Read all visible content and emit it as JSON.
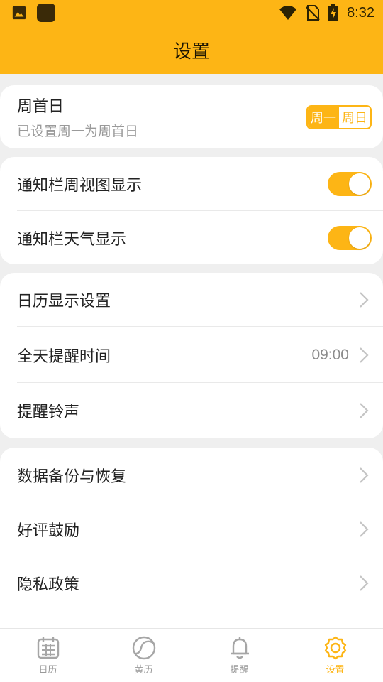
{
  "status_bar": {
    "time": "8:32"
  },
  "app_bar": {
    "title": "设置"
  },
  "first_day": {
    "title": "周首日",
    "subtitle": "已设置周一为周首日",
    "options": [
      "周一",
      "周日"
    ],
    "selected": "周一"
  },
  "toggles": [
    {
      "label": "通知栏周视图显示",
      "on": true
    },
    {
      "label": "通知栏天气显示",
      "on": true
    }
  ],
  "group_reminders": [
    {
      "label": "日历显示设置"
    },
    {
      "label": "全天提醒时间",
      "value": "09:00"
    },
    {
      "label": "提醒铃声"
    }
  ],
  "group_misc": [
    {
      "label": "数据备份与恢复"
    },
    {
      "label": "好评鼓励"
    },
    {
      "label": "隐私政策"
    }
  ],
  "bottom_nav": {
    "items": [
      {
        "label": "日历",
        "icon": "calendar-icon"
      },
      {
        "label": "黄历",
        "icon": "almanac-icon"
      },
      {
        "label": "提醒",
        "icon": "bell-icon"
      },
      {
        "label": "设置",
        "icon": "gear-icon"
      }
    ],
    "active": "设置"
  },
  "colors": {
    "accent": "#fdb515",
    "background": "#efefef",
    "inactive": "#9a9a9a"
  }
}
